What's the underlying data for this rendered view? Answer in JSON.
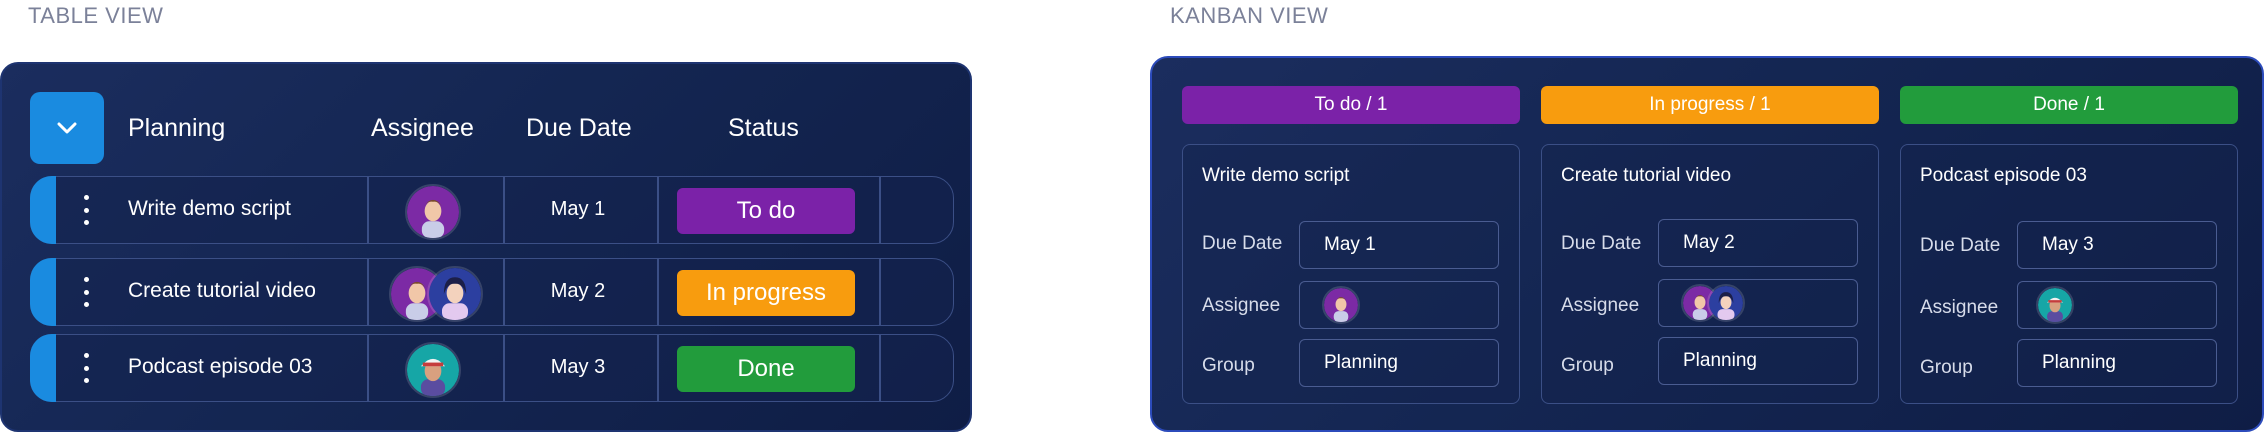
{
  "table_view": {
    "section_label": "TABLE VIEW",
    "headers": {
      "group": "Planning",
      "assignee": "Assignee",
      "due_date": "Due Date",
      "status": "Status"
    },
    "rows": [
      {
        "name": "Write demo script",
        "due": "May 1",
        "status": "To do",
        "status_color": "#7b22a8",
        "assignees": [
          "avatar-purple-man"
        ]
      },
      {
        "name": "Create tutorial video",
        "due": "May 2",
        "status": "In progress",
        "status_color": "#f89c0e",
        "assignees": [
          "avatar-purple-man",
          "avatar-blue-woman"
        ]
      },
      {
        "name": "Podcast episode 03",
        "due": "May 3",
        "status": "Done",
        "status_color": "#229c3c",
        "assignees": [
          "avatar-teal-cap-man"
        ]
      }
    ]
  },
  "kanban_view": {
    "section_label": "KANBAN VIEW",
    "field_labels": {
      "due_date": "Due Date",
      "assignee": "Assignee",
      "group": "Group"
    },
    "columns": [
      {
        "title": "To do / 1",
        "color": "#7b22a8",
        "card": {
          "title": "Write demo script",
          "due": "May 1",
          "group": "Planning",
          "assignees": [
            "avatar-purple-man"
          ]
        }
      },
      {
        "title": "In progress / 1",
        "color": "#f89c0e",
        "card": {
          "title": "Create tutorial video",
          "due": "May 2",
          "group": "Planning",
          "assignees": [
            "avatar-purple-man",
            "avatar-blue-woman"
          ]
        }
      },
      {
        "title": "Done / 1",
        "color": "#229c3c",
        "card": {
          "title": "Podcast episode 03",
          "due": "May 3",
          "group": "Planning",
          "assignees": [
            "avatar-teal-cap-man"
          ]
        }
      }
    ]
  },
  "icons": {
    "collapse": "chevron-down-icon",
    "row_menu": "kebab-menu-icon"
  },
  "colors": {
    "accent": "#1a8be0",
    "panel_bg": "#142652"
  }
}
